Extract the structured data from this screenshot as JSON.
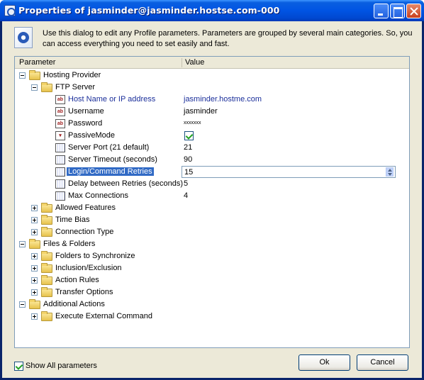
{
  "window": {
    "title": "Properties of jasminder@jasminder.hostse.com-000",
    "controls": [
      "minimize",
      "maximize",
      "close"
    ]
  },
  "header": {
    "description": "Use this dialog to edit any Profile parameters. Parameters are grouped by several main categories. So, you can access everything you need to set easily and fast."
  },
  "grid": {
    "columns": {
      "parameter": "Parameter",
      "value": "Value"
    },
    "rows": [
      {
        "label": "Hosting Provider",
        "type": "category",
        "expanded": true
      },
      {
        "label": "FTP Server",
        "type": "group",
        "expanded": true
      },
      {
        "label": "Host Name or IP address",
        "type": "text",
        "value": "jasminder.hostme.com"
      },
      {
        "label": "Username",
        "type": "text",
        "value": "jasminder"
      },
      {
        "label": "Password",
        "type": "text",
        "value": "xxxxxxx"
      },
      {
        "label": "PassiveMode",
        "type": "bool",
        "value": true
      },
      {
        "label": "Server Port (21 default)",
        "type": "number",
        "value": "21"
      },
      {
        "label": "Server Timeout (seconds)",
        "type": "number",
        "value": "90"
      },
      {
        "label": "Login/Command Retries",
        "type": "number",
        "value": "15",
        "selected": true
      },
      {
        "label": "Delay between Retries (seconds)",
        "type": "number",
        "value": "5"
      },
      {
        "label": "Max Connections",
        "type": "number",
        "value": "4"
      },
      {
        "label": "Allowed Features",
        "type": "group",
        "expanded": false
      },
      {
        "label": "Time Bias",
        "type": "group",
        "expanded": false
      },
      {
        "label": "Connection Type",
        "type": "group",
        "expanded": false
      },
      {
        "label": "Files & Folders",
        "type": "category",
        "expanded": true
      },
      {
        "label": "Folders to Synchronize",
        "type": "group",
        "expanded": false
      },
      {
        "label": "Inclusion/Exclusion",
        "type": "group",
        "expanded": false
      },
      {
        "label": "Action Rules",
        "type": "group",
        "expanded": false
      },
      {
        "label": "Transfer Options",
        "type": "group",
        "expanded": false
      },
      {
        "label": "Additional Actions",
        "type": "category",
        "expanded": true
      },
      {
        "label": "Execute External Command",
        "type": "group",
        "expanded": false
      }
    ]
  },
  "footer": {
    "show_all_label": "Show All parameters",
    "show_all_checked": true,
    "ok_label": "Ok",
    "cancel_label": "Cancel"
  },
  "colors": {
    "titlebar": "#0054e3",
    "selection": "#316ac5",
    "link_text": "#1a2e9a",
    "dialog_bg": "#ece9d8"
  }
}
